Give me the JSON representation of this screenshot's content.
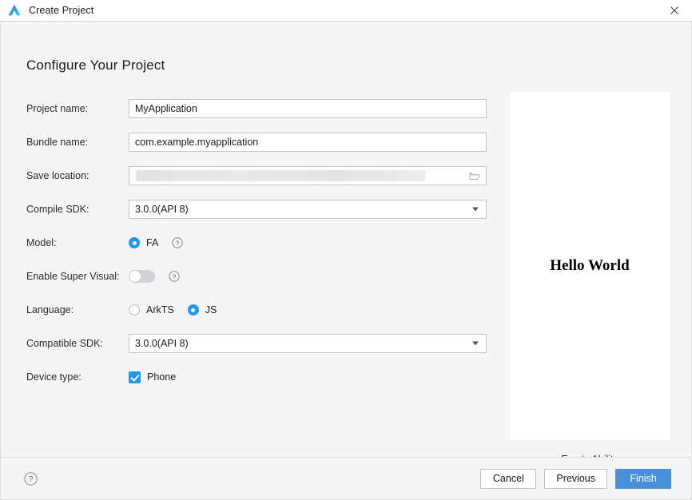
{
  "titlebar": {
    "title": "Create Project",
    "app_icon": "huawei-devtool-logo-icon",
    "close_icon": "close-icon"
  },
  "page": {
    "heading": "Configure Your Project"
  },
  "form": {
    "project_name": {
      "label": "Project name:",
      "value": "MyApplication"
    },
    "bundle_name": {
      "label": "Bundle name:",
      "value": "com.example.myapplication"
    },
    "save_location": {
      "label": "Save location:",
      "value": "",
      "browse_icon": "folder-icon"
    },
    "compile_sdk": {
      "label": "Compile SDK:",
      "value": "3.0.0(API 8)",
      "arrow_icon": "chevron-down-icon"
    },
    "model": {
      "label": "Model:",
      "options": [
        {
          "label": "FA",
          "selected": true
        }
      ],
      "help_icon": "help-circle-icon"
    },
    "enable_super_visual": {
      "label": "Enable Super Visual:",
      "state": "off",
      "help_icon": "help-circle-icon"
    },
    "language": {
      "label": "Language:",
      "options": [
        {
          "label": "ArkTS",
          "selected": false
        },
        {
          "label": "JS",
          "selected": true
        }
      ]
    },
    "compatible_sdk": {
      "label": "Compatible SDK:",
      "value": "3.0.0(API 8)",
      "arrow_icon": "chevron-down-icon"
    },
    "device_type": {
      "label": "Device type:",
      "options": [
        {
          "label": "Phone",
          "checked": true
        }
      ]
    }
  },
  "preview": {
    "hello_text": "Hello World",
    "caption": "Empty Ability"
  },
  "footer": {
    "help_icon": "help-circle-icon",
    "cancel": "Cancel",
    "previous": "Previous",
    "finish": "Finish"
  },
  "colors": {
    "accent": "#2196f3",
    "primary_button": "#4a90d9",
    "background": "#f5f5f5"
  }
}
